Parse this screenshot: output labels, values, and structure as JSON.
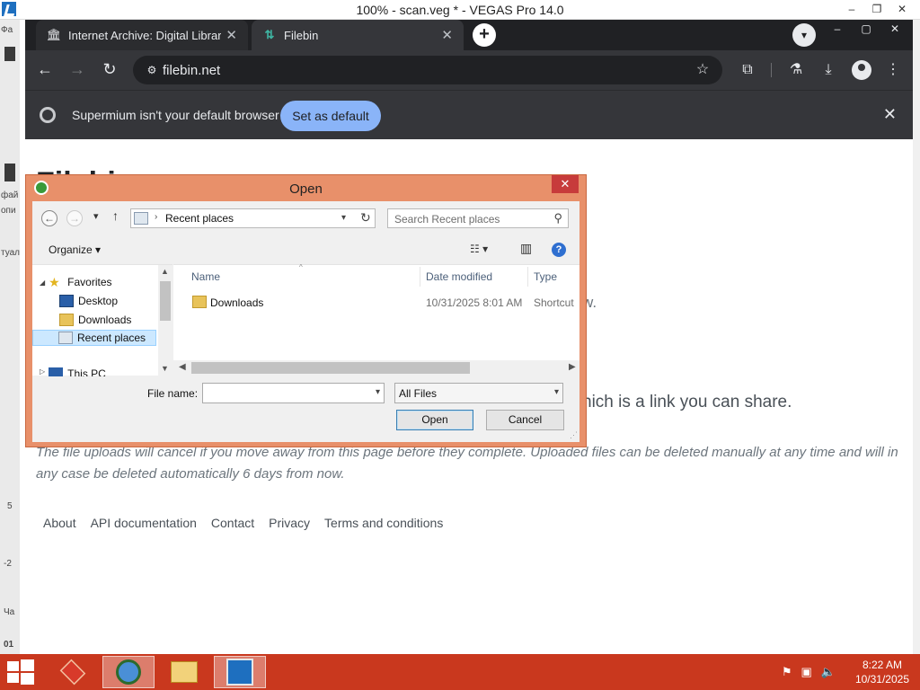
{
  "vegas": {
    "title": "100% - scan.veg * - VEGAS Pro 14.0",
    "controls": [
      "–",
      "❐",
      "✕"
    ],
    "fragments": [
      "Фа",
      "фай",
      "опи",
      "туал",
      "5",
      "-2",
      "Ча",
      "01"
    ]
  },
  "browser": {
    "tabs": [
      {
        "label": "Internet Archive: Digital Library",
        "icon": "institution-icon"
      },
      {
        "label": "Filebin",
        "icon": "filebin-icon"
      }
    ],
    "window_controls": [
      "–",
      "▢",
      "✕"
    ],
    "url": "filebin.net",
    "infobar": {
      "text": "Supermium isn't your default browser",
      "button": "Set as default"
    }
  },
  "page": {
    "heading": "Filebin",
    "line1_tail": "w.",
    "line2_tail": "hich is a link you can share.",
    "note": "The file uploads will cancel if you move away from this page before they complete. Uploaded files can be deleted manually at any time and will in any case be deleted automatically 6 days from now.",
    "footer_links": [
      "About",
      "API documentation",
      "Contact",
      "Privacy",
      "Terms and conditions"
    ]
  },
  "dialog": {
    "title": "Open",
    "address": "Recent places",
    "search_placeholder": "Search Recent places",
    "organize": "Organize ▾",
    "nav": {
      "favorites": "Favorites",
      "items": [
        "Desktop",
        "Downloads",
        "Recent places"
      ],
      "this_pc": "This PC"
    },
    "columns": [
      "Name",
      "Date modified",
      "Type"
    ],
    "files": [
      {
        "name": "Downloads",
        "date": "10/31/2025 8:01 AM",
        "type": "Shortcut"
      }
    ],
    "file_name_label": "File name:",
    "file_name_value": "",
    "file_type": "All Files",
    "open_button": "Open",
    "cancel_button": "Cancel"
  },
  "taskbar": {
    "time": "8:22 AM",
    "date": "10/31/2025"
  },
  "colors": {
    "taskbar": "#c9381e",
    "dialog_frame": "#e8906a",
    "infobar_button": "#8ab4f8",
    "browser_dark": "#35363a"
  }
}
